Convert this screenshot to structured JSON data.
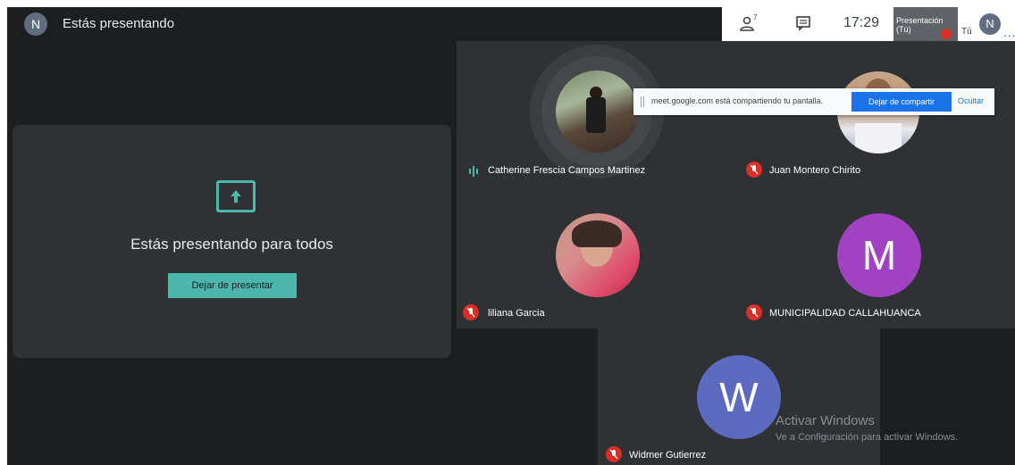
{
  "topbar": {
    "avatar_letter": "N",
    "title": "Estás presentando"
  },
  "rightbar": {
    "people_icon": "people-icon",
    "people_count": "7",
    "chat_icon": "chat-icon",
    "time": "17:29",
    "thumb_label": "Presentación (Tú)",
    "tu_label": "Tú",
    "avatar_letter": "N",
    "more": "..."
  },
  "presenting": {
    "icon": "present-screen-icon",
    "message": "Estás presentando para todos",
    "stop_button": "Dejar de presentar"
  },
  "share_bar": {
    "text": "meet.google.com está compartiendo tu pantalla.",
    "stop_button": "Dejar de compartir",
    "hide_link": "Ocultar"
  },
  "participants": [
    {
      "name": "Catherine Frescia Campos Martinez",
      "status": "speaking"
    },
    {
      "name": "Juan Montero Chirito",
      "status": "muted"
    },
    {
      "name": "liliana Garcia",
      "status": "muted"
    },
    {
      "name": "MUNICIPALIDAD CALLAHUANCA",
      "status": "muted",
      "initial": "M"
    },
    {
      "name": "Widmer Gutierrez",
      "status": "muted",
      "initial": "W"
    }
  ],
  "colors": {
    "accent": "#4db6ac",
    "blue": "#1a73e8",
    "muted_red": "#d93025",
    "avatar_m": "#a142c2",
    "avatar_w": "#5c6bc0"
  },
  "watermark": {
    "title": "Activar Windows",
    "subtitle": "Ve a Configuración para activar Windows."
  }
}
